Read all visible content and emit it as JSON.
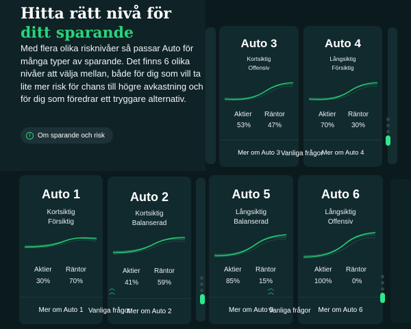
{
  "intro": {
    "headline_line1": "Hitta rätt nivå för",
    "headline_line2": "ditt sparande",
    "body": "Med flera olika risknivåer så passar Auto för många typer av sparande. Det finns 6 olika nivåer att välja mellan, både för dig som vill ta lite mer risk för chans till högre avkastning och för dig som föredrar ett tryggare alternativ.",
    "button_label": "Om sparande och risk",
    "button_icon": "info-icon"
  },
  "labels": {
    "stocks": "Aktier",
    "bonds": "Räntor"
  },
  "faq_label": "Vanliga frågor",
  "accent_color": "#29d37b",
  "cards": {
    "auto1": {
      "title": "Auto 1",
      "line1": "Kortsiktig",
      "line2": "Försiktig",
      "stocks": "30%",
      "bonds": "70%",
      "link": "Mer om Auto 1"
    },
    "auto2": {
      "title": "Auto 2",
      "line1": "Kortsiktig",
      "line2": "Balanserad",
      "stocks": "41%",
      "bonds": "59%",
      "link": "Mer om Auto 2"
    },
    "auto3": {
      "title": "Auto 3",
      "line1": "Kortsiktig",
      "line2": "Offensiv",
      "stocks": "53%",
      "bonds": "47%",
      "link": "Mer om Auto 3"
    },
    "auto4": {
      "title": "Auto 4",
      "line1": "Långsiktig",
      "line2": "Försiktig",
      "stocks": "70%",
      "bonds": "30%",
      "link": "Mer om Auto 4"
    },
    "auto5": {
      "title": "Auto 5",
      "line1": "Långsiktig",
      "line2": "Balanserad",
      "stocks": "85%",
      "bonds": "15%",
      "link": "Mer om Auto 5"
    },
    "auto6": {
      "title": "Auto 6",
      "line1": "Långsiktig",
      "line2": "Offensiv",
      "stocks": "100%",
      "bonds": "0%",
      "link": "Mer om Auto 6"
    }
  }
}
